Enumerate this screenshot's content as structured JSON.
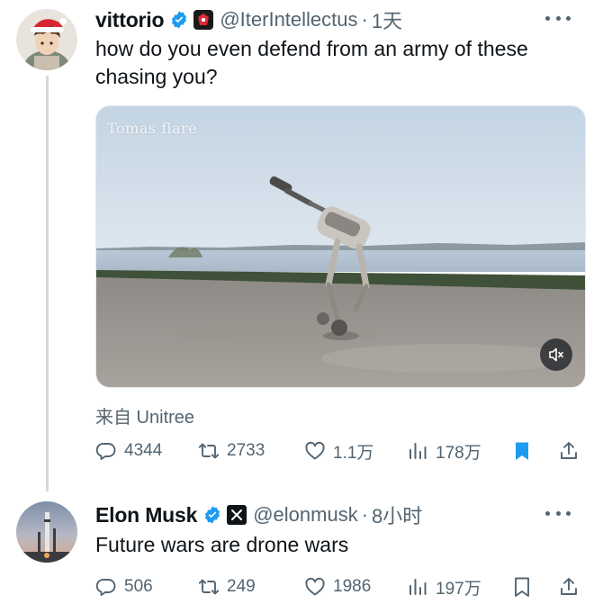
{
  "tweet1": {
    "author_name": "vittorio",
    "handle": "@IterIntellectus",
    "time": "1天",
    "text": "how do you even defend from an army of these chasing you?",
    "media": {
      "watermark": "Tomas flare",
      "icon": "mute-icon"
    },
    "source": "来自 Unitree",
    "stats": {
      "replies": "4344",
      "reposts": "2733",
      "likes": "1.1万",
      "views": "178万"
    },
    "bookmarked": true
  },
  "tweet2": {
    "author_name": "Elon Musk",
    "handle": "@elonmusk",
    "time": "8小时",
    "text": "Future wars are drone wars",
    "stats": {
      "replies": "506",
      "reposts": "249",
      "likes": "1986",
      "views": "197万"
    },
    "bookmarked": false
  },
  "colors": {
    "verified": "#1d9bf0",
    "bookmark_active": "#1d9bf0",
    "secondary": "#536471"
  }
}
